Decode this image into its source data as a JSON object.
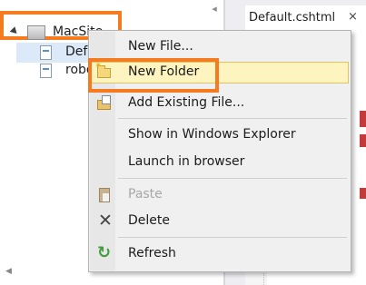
{
  "editor": {
    "tab_title": "Default.cshtml",
    "tab_close": "×"
  },
  "tree": {
    "scroll_left_glyph": "◂",
    "root": {
      "label": "MacSite",
      "icon": "web-project-icon"
    },
    "children": [
      {
        "label": "Defa",
        "icon": "cshtml-file-icon",
        "selected": true
      },
      {
        "label": "robo",
        "icon": "text-file-icon",
        "selected": false
      }
    ],
    "hscroll_glyph": "◀"
  },
  "context_menu": {
    "items": [
      {
        "label": "New File...",
        "icon": "none",
        "enabled": true
      },
      {
        "label": "New Folder",
        "icon": "new-folder-icon",
        "enabled": true,
        "hovered": true
      },
      {
        "label": "Add Existing File...",
        "icon": "add-existing-file-icon",
        "enabled": true
      },
      {
        "label": "Show in Windows Explorer",
        "icon": "none",
        "enabled": true
      },
      {
        "label": "Launch in browser",
        "icon": "none",
        "enabled": true
      },
      {
        "label": "Paste",
        "icon": "paste-icon",
        "enabled": false
      },
      {
        "label": "Delete",
        "icon": "delete-icon",
        "enabled": true
      },
      {
        "label": "Refresh",
        "icon": "refresh-icon",
        "enabled": true
      }
    ],
    "glyphs": {
      "delete": "✕",
      "refresh": "↻",
      "star": "✶"
    }
  },
  "colors": {
    "annotation_orange": "#f47b20",
    "hover_fill": "#fdf4bf",
    "selection_blue": "#dbe9f8"
  }
}
